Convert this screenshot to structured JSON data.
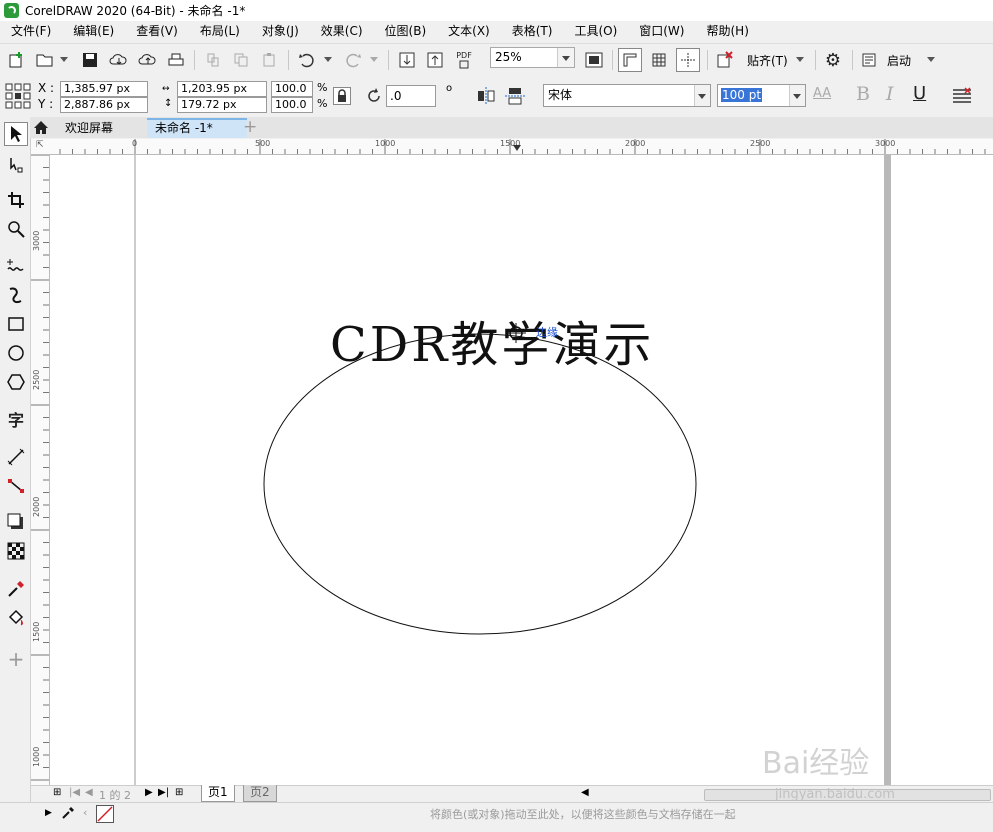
{
  "title_bar": {
    "title": "CorelDRAW 2020 (64-Bit) - 未命名 -1*"
  },
  "menu": [
    "文件(F)",
    "编辑(E)",
    "查看(V)",
    "布局(L)",
    "对象(J)",
    "效果(C)",
    "位图(B)",
    "文本(X)",
    "表格(T)",
    "工具(O)",
    "窗口(W)",
    "帮助(H)"
  ],
  "toolbar": {
    "zoom": "25%",
    "snap_label": "贴齐(T)",
    "launch_label": "启动",
    "pdf_label": "PDF"
  },
  "property_bar": {
    "x_label": "X :",
    "y_label": "Y :",
    "x_value": "1,385.97 px",
    "y_value": "2,887.86 px",
    "width_value": "1,203.95 px",
    "height_value": "179.72 px",
    "scale_w": "100.0",
    "scale_h": "100.0",
    "percent": "%",
    "rotation": ".0",
    "degree_symbol": "o",
    "font_name": "宋体",
    "font_size": "100 pt",
    "bold": "B",
    "italic": "I",
    "underline": "U",
    "aa_label": "AA"
  },
  "tabs": {
    "welcome": "欢迎屏幕",
    "document": "未命名 -1*"
  },
  "rulers": {
    "top": [
      "0",
      "500",
      "1000",
      "1500",
      "2000",
      "2500",
      "3000"
    ],
    "left": [
      "3000",
      "2500",
      "2000",
      "1500",
      "1000"
    ]
  },
  "canvas": {
    "text": "CDR教学演示",
    "snap_tooltip": "边缘"
  },
  "page_nav": {
    "page_count_text": "1 的 2",
    "page1": "页1",
    "page2": "页2"
  },
  "status": {
    "hint": "将颜色(或对象)拖动至此处，以便将这些颜色与文档存储在一起"
  },
  "watermark": {
    "brand": "Bai经验",
    "url": "jingyan.baidu.com"
  }
}
